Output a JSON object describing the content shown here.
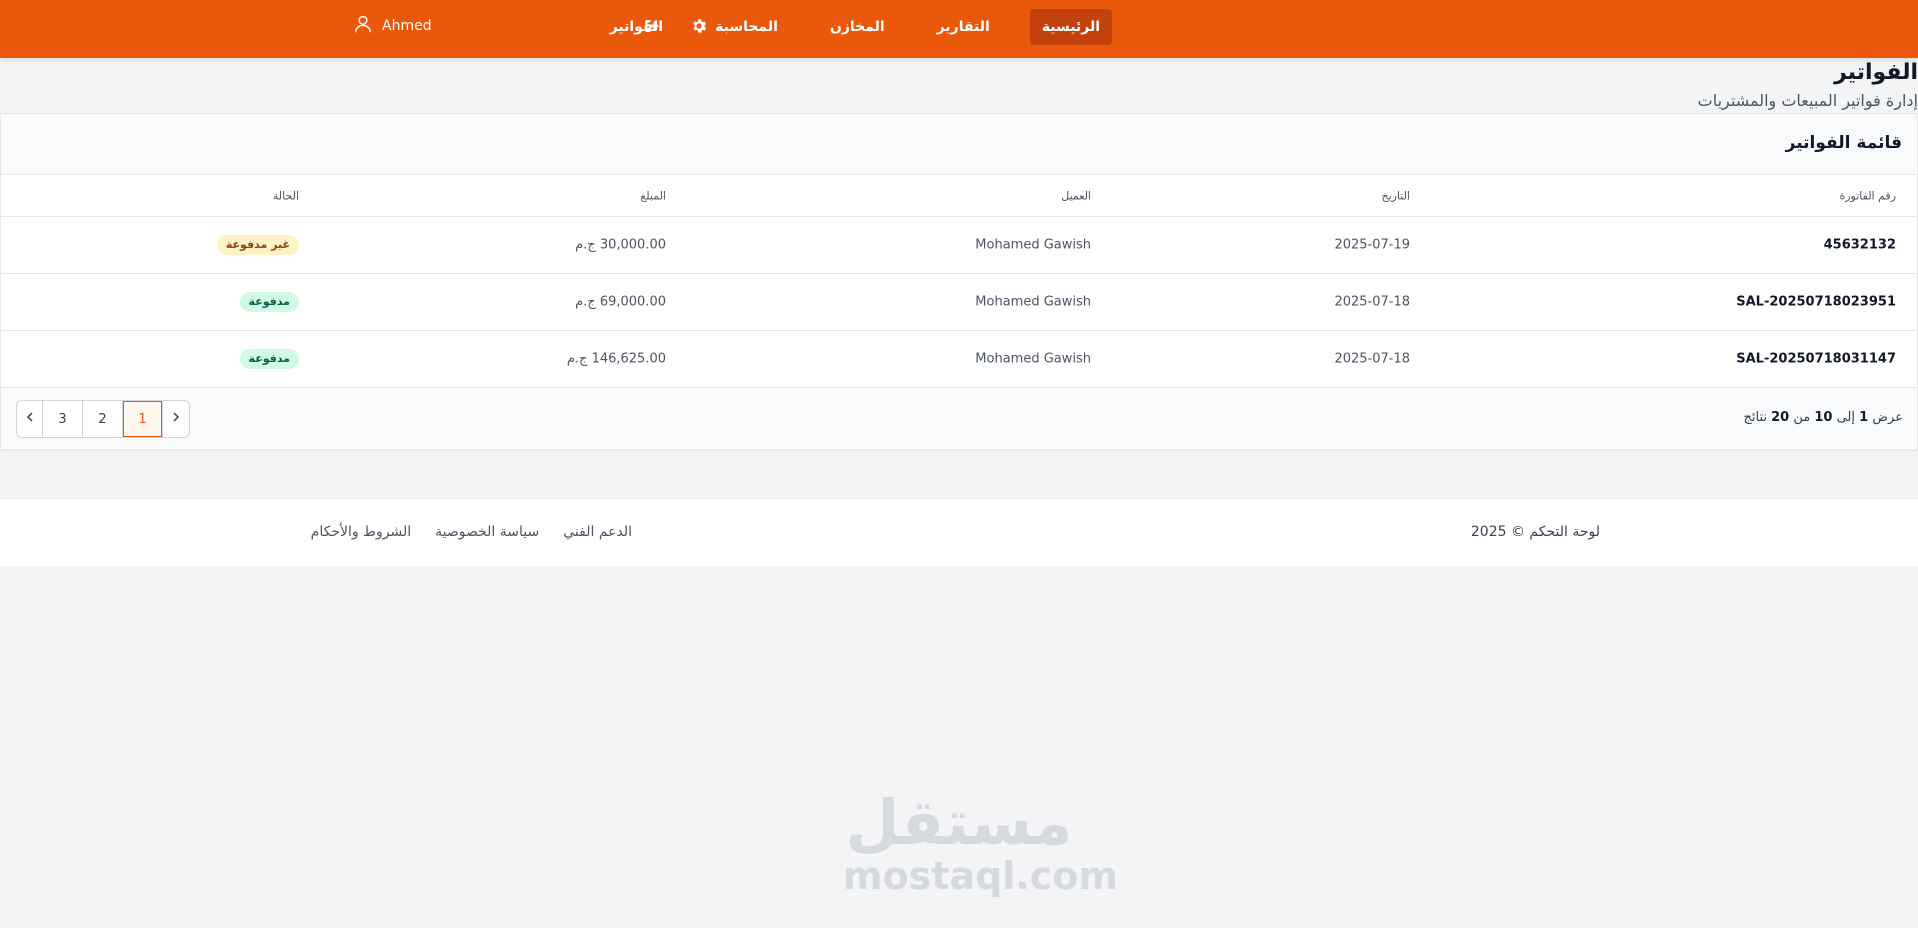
{
  "topbar": {
    "user_name": "Ahmed",
    "nav": [
      {
        "label": "الرئيسية",
        "active": true
      },
      {
        "label": "التقارير",
        "active": false
      },
      {
        "label": "المخازن",
        "active": false
      },
      {
        "label": "المحاسبة",
        "active": false
      },
      {
        "label": "الفواتير",
        "active": false
      }
    ],
    "icons": {
      "user": "user-icon",
      "logout": "logout-icon",
      "settings": "gear-icon"
    },
    "colors": {
      "bar": "#ea580c",
      "active_tab": "#c2410c"
    }
  },
  "page": {
    "title": "الفواتير",
    "subtitle": "إدارة فواتير المبيعات والمشتريات"
  },
  "invoices": {
    "card_title": "قائمة الفواتير",
    "columns": {
      "number": "رقم الفاتورة",
      "date": "التاريخ",
      "customer": "العميل",
      "amount": "المبلغ",
      "status": "الحالة"
    },
    "rows": [
      {
        "number": "45632132",
        "date": "2025-07-19",
        "customer": "Mohamed Gawish",
        "amount": "30,000.00 ج.م",
        "status": "غير مدفوعة",
        "status_type": "unpaid"
      },
      {
        "number": "SAL-20250718023951",
        "date": "2025-07-18",
        "customer": "Mohamed Gawish",
        "amount": "69,000.00 ج.م",
        "status": "مدفوعة",
        "status_type": "paid"
      },
      {
        "number": "SAL-20250718031147",
        "date": "2025-07-18",
        "customer": "Mohamed Gawish",
        "amount": "146,625.00 ج.م",
        "status": "مدفوعة",
        "status_type": "paid"
      }
    ],
    "results": {
      "prefix": "عرض",
      "from": "1",
      "to_word": "إلى",
      "to": "10",
      "of_word": "من",
      "total": "20",
      "suffix": "نتائج"
    },
    "pagination": {
      "pages": [
        "1",
        "2",
        "3"
      ],
      "current": "1"
    }
  },
  "footer": {
    "copyright": "لوحة التحكم © 2025",
    "links": [
      "الشروط والأحكام",
      "سياسة الخصوصية",
      "الدعم الفني"
    ]
  },
  "watermark": {
    "arabic": "مستقل",
    "latin": "mostaql.com"
  }
}
